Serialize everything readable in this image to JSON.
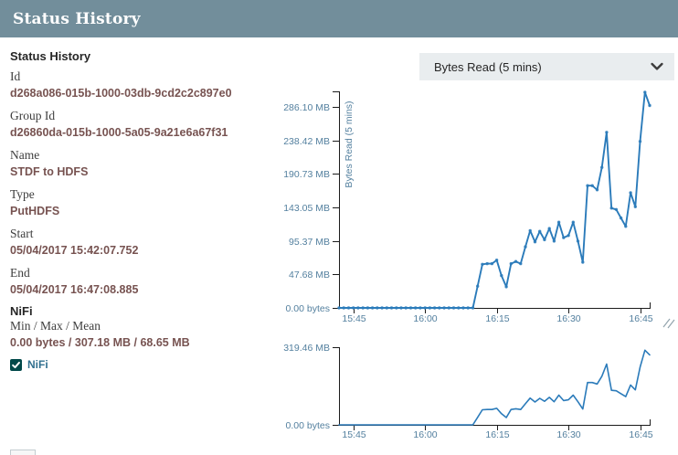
{
  "dialog": {
    "title": "Status History"
  },
  "details": {
    "heading": "Status History",
    "fields": [
      {
        "label": "Id",
        "value": "d268a086-015b-1000-03db-9cd2c2c897e0"
      },
      {
        "label": "Group Id",
        "value": "d26860da-015b-1000-5a05-9a21e6a67f31"
      },
      {
        "label": "Name",
        "value": "STDF to HDFS"
      },
      {
        "label": "Type",
        "value": "PutHDFS"
      },
      {
        "label": "Start",
        "value": "05/04/2017 15:42:07.752"
      },
      {
        "label": "End",
        "value": "05/04/2017 16:47:08.885"
      }
    ],
    "node_section": {
      "heading": "NiFi",
      "stat_label": "Min / Max / Mean",
      "stat_value": "0.00 bytes / 307.18 MB / 68.65 MB"
    },
    "legend": [
      {
        "label": "NiFi",
        "checked": true
      }
    ]
  },
  "metric_select": {
    "value": "Bytes Read (5 mins)"
  },
  "colors": {
    "header_bg": "#728e9b",
    "value_text": "#775351",
    "checkbox_teal": "#004849",
    "legend_label": "#31708f",
    "axis_line": "#1b1b1b",
    "tick_text": "#54809f",
    "grip": "#93a4ad"
  },
  "chart_data": {
    "type": "line",
    "ylabel": "Bytes Read (5 mins)",
    "x_start": "15:42",
    "x_end": "16:47",
    "x_ticks": [
      "15:45",
      "16:00",
      "16:15",
      "16:30",
      "16:45"
    ],
    "main_y_ticks": [
      {
        "value": 0,
        "label": "0.00 bytes"
      },
      {
        "value": 47.68,
        "label": "47.68 MB"
      },
      {
        "value": 95.37,
        "label": "95.37 MB"
      },
      {
        "value": 143.05,
        "label": "143.05 MB"
      },
      {
        "value": 190.73,
        "label": "190.73 MB"
      },
      {
        "value": 238.42,
        "label": "238.42 MB"
      },
      {
        "value": 286.1,
        "label": "286.10 MB"
      }
    ],
    "mini_y_ticks": [
      {
        "value": 0,
        "label": "0.00 bytes"
      },
      {
        "value": 319.46,
        "label": "319.46 MB"
      }
    ],
    "main_ylim": [
      0,
      308
    ],
    "mini_ylim": [
      0,
      319.46
    ],
    "grid": false,
    "legend_position": "left-panel",
    "series": [
      {
        "name": "NiFi",
        "color": "#2b7bba",
        "values_mb": [
          0,
          0,
          0,
          0,
          0,
          0,
          0,
          0,
          0,
          0,
          0,
          0,
          0,
          0,
          0,
          0,
          0,
          0,
          0,
          0,
          0,
          0,
          0,
          0,
          0,
          0,
          0,
          0,
          0,
          31,
          62,
          63,
          63,
          68,
          46,
          30,
          63,
          66,
          63,
          87,
          110,
          94,
          109,
          97,
          113,
          95,
          122,
          100,
          103,
          122,
          95,
          65,
          174,
          174,
          168,
          200,
          250,
          142,
          140,
          128,
          116,
          164,
          144,
          237,
          307,
          288
        ]
      }
    ]
  }
}
